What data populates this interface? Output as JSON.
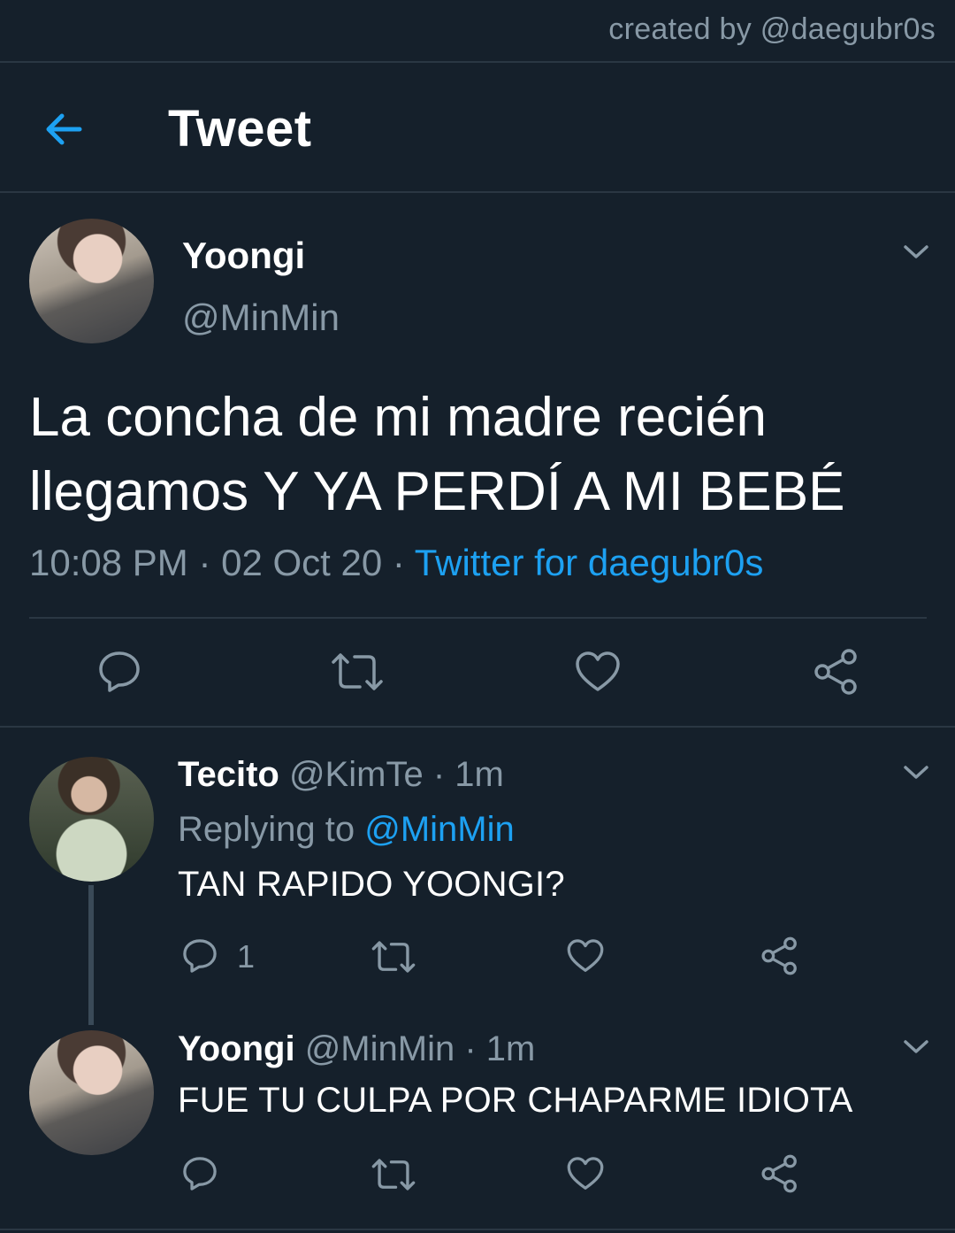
{
  "watermark": "created by @daegubr0s",
  "header": {
    "title": "Tweet",
    "back_icon": "back-arrow-icon"
  },
  "accent_color": "#1da1f2",
  "background_color": "#15202b",
  "main_tweet": {
    "name": "Yoongi",
    "handle": "@MinMin",
    "text": "La concha de mi madre recién llegamos Y YA PERDÍ A MI BEBÉ",
    "time": "10:08 PM",
    "sep1": " · ",
    "date": "02 Oct 20",
    "sep2": " · ",
    "source": "Twitter for daegubr0s"
  },
  "replies": [
    {
      "name": "Tecito",
      "handle": "@KimTe",
      "ago": " · 1m",
      "replying_prefix": "Replying to ",
      "replying_to": "@MinMin",
      "text": "TAN RAPIDO YOONGI?",
      "reply_count": "1"
    },
    {
      "name": "Yoongi",
      "handle": "@MinMin",
      "ago": " · 1m",
      "text": "FUE TU CULPA POR CHAPARME IDIOTA"
    }
  ]
}
